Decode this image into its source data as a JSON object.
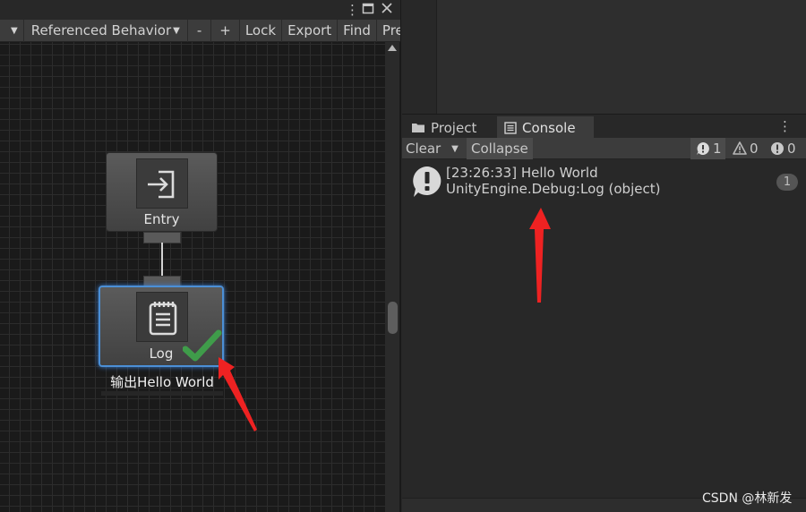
{
  "graph_panel": {
    "toolbar": {
      "referenced_behavior": "Referenced Behavior",
      "minus": "-",
      "plus": "+",
      "lock": "Lock",
      "export": "Export",
      "find": "Find",
      "preferences_partial": "Pre"
    },
    "entry_node": {
      "label": "Entry",
      "icon": "entry-arrow-icon"
    },
    "log_node": {
      "label": "Log",
      "icon": "clipboard-icon",
      "status": "success",
      "comment": "输出Hello World"
    }
  },
  "console_panel": {
    "tabs": [
      {
        "label": "Project",
        "icon": "folder-icon"
      },
      {
        "label": "Console",
        "icon": "console-list-icon"
      }
    ],
    "toolbar": {
      "clear": "Clear",
      "collapse": "Collapse",
      "log_count": "1",
      "warning_count": "0",
      "error_count": "0"
    },
    "entries": [
      {
        "line1": "[23:26:33] Hello World",
        "line2": "UnityEngine.Debug:Log (object)",
        "count": "1"
      }
    ]
  },
  "watermark": "CSDN @林新发",
  "colors": {
    "accent_red": "#ee2222",
    "selection_blue": "#4b8fd6",
    "check_green": "#3f9c4a"
  }
}
